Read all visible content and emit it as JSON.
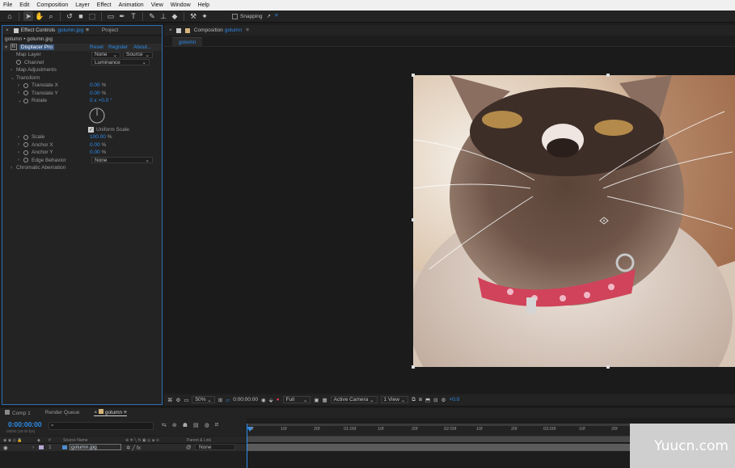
{
  "menu": [
    "File",
    "Edit",
    "Composition",
    "Layer",
    "Effect",
    "Animation",
    "View",
    "Window",
    "Help"
  ],
  "toolbar": {
    "tools": [
      "home-icon",
      "selection-icon",
      "hand-icon",
      "zoom-icon",
      "rotate-icon",
      "camera-icon",
      "pan-behind-icon",
      "rectangle-icon",
      "pen-icon",
      "type-icon",
      "brush-icon",
      "clone-stamp-icon",
      "eraser-icon",
      "roto-brush-icon",
      "puppet-icon"
    ],
    "snapping_label": "Snapping"
  },
  "left_panel": {
    "tab_effect_controls": "Effect Controls",
    "tab_effect_file": "golumn.jpg",
    "tab_project": "Project",
    "breadcrumb": "golumn • golumn.jpg",
    "effect_name": "Displacer Pro",
    "reset": "Reset",
    "register": "Register",
    "about": "About...",
    "map_layer_label": "Map Layer",
    "map_layer_value": "None",
    "map_layer_source": "Source",
    "channel_label": "Channel",
    "channel_value": "Luminance",
    "map_adjustments": "Map Adjustments",
    "transform": "Transform",
    "translate_x_label": "Translate X",
    "translate_x_value": "0.00",
    "translate_y_label": "Translate Y",
    "translate_y_value": "0.00",
    "percent": "%",
    "rotate_label": "Rotate",
    "rotate_value": "0 x +0.0 °",
    "uniform_scale": "Uniform Scale",
    "scale_label": "Scale",
    "scale_value": "100.00",
    "anchor_x_label": "Anchor X",
    "anchor_x_value": "0.00",
    "anchor_y_label": "Anchor Y",
    "anchor_y_value": "0.00",
    "edge_behavior_label": "Edge Behavior",
    "edge_behavior_value": "None",
    "chromatic_aberration": "Chromatic Aberration"
  },
  "comp_panel": {
    "tab_label": "Composition",
    "tab_name": "golumn",
    "subtab": "golumn"
  },
  "viewer_bar": {
    "zoom": "50%",
    "timecode": "0:00:00:00",
    "resolution": "Full",
    "camera": "Active Camera",
    "views": "1 View",
    "exposure": "+0.0"
  },
  "timeline": {
    "tab_comp1": "Comp 1",
    "tab_render_queue": "Render Queue",
    "tab_golumn": "golumn",
    "timecode": "0:00:00:00",
    "fps_hint": "00000 (30.00 fps)",
    "search_placeholder": "",
    "col_source_name": "Source Name",
    "col_parent_link": "Parent & Link",
    "layer_number": "1",
    "layer_name": "golumn.jpg",
    "layer_parent": "None",
    "ruler_labels": [
      "0f",
      "10f",
      "20f",
      "01:00f",
      "10f",
      "20f",
      "02:00f",
      "10f",
      "20f",
      "03:00f",
      "10f",
      "20f"
    ]
  },
  "watermark": "Yuucn.com"
}
